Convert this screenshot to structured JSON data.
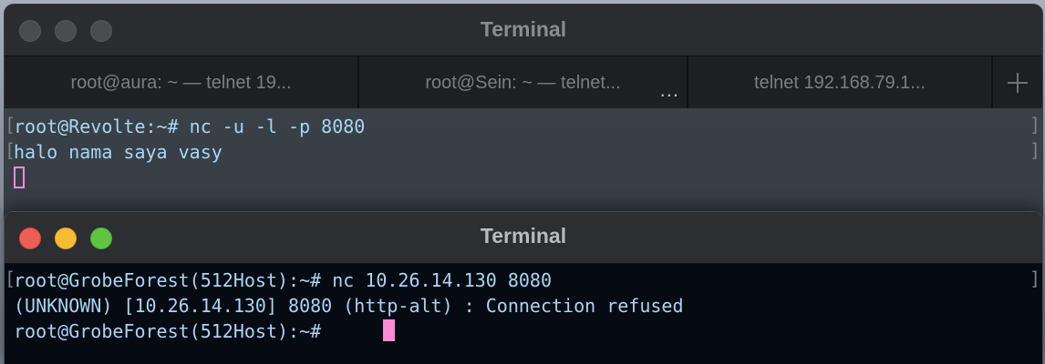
{
  "back_window": {
    "title": "Terminal",
    "tabs": [
      {
        "label": "root@aura: ~ — telnet 19..."
      },
      {
        "label": "root@Sein: ~ — telnet..."
      },
      {
        "label": "telnet 192.168.79.1..."
      }
    ],
    "tab_more_label": "...",
    "lines": [
      "root@Revolte:~# nc -u -l -p 8080",
      "halo nama saya vasy"
    ],
    "bracket_left": "[",
    "bracket_right": "]"
  },
  "front_window": {
    "title": "Terminal",
    "lines": [
      "root@GrobeForest(512Host):~# nc 10.26.14.130 8080",
      "(UNKNOWN) [10.26.14.130] 8080 (http-alt) : Connection refused",
      "root@GrobeForest(512Host):~# "
    ],
    "bracket_left": "[",
    "bracket_right": "]"
  },
  "icons": {
    "close": "close-icon",
    "minimize": "minimize-icon",
    "zoom": "zoom-icon",
    "new_tab": "plus-icon",
    "tab_more": "ellipsis-icon"
  },
  "colors": {
    "terminal_text": "#a8d6f2",
    "cursor": "#ff8ad8",
    "close_red": "#ec5f57",
    "minimize_yellow": "#f5bd33",
    "zoom_green": "#5fc541"
  }
}
